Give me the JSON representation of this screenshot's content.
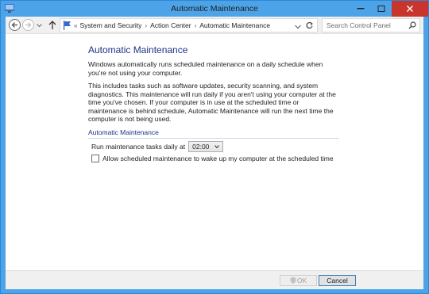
{
  "window": {
    "title": "Automatic Maintenance"
  },
  "nav": {
    "breadcrumbs": [
      "System and Security",
      "Action Center",
      "Automatic Maintenance"
    ],
    "breadcrumb_prefix": "«",
    "search_placeholder": "Search Control Panel"
  },
  "content": {
    "heading": "Automatic Maintenance",
    "para1": "Windows automatically runs scheduled maintenance on a daily schedule when you're not using your computer.",
    "para2": "This includes tasks such as software updates, security scanning, and system diagnostics. This maintenance will run daily if you aren't using your computer at the time you've chosen. If your computer is in use at the scheduled time or maintenance is behind schedule, Automatic Maintenance will run the next time the computer is not being used.",
    "group_title": "Automatic Maintenance",
    "run_label": "Run maintenance tasks daily at",
    "run_time": "02:00",
    "wake_label": "Allow scheduled maintenance to wake up my computer at the scheduled time",
    "wake_checked": false
  },
  "footer": {
    "ok_label": "OK",
    "cancel_label": "Cancel"
  },
  "colors": {
    "titlebar": "#4da3e8",
    "close": "#c7352c",
    "heading": "#1e3287"
  }
}
